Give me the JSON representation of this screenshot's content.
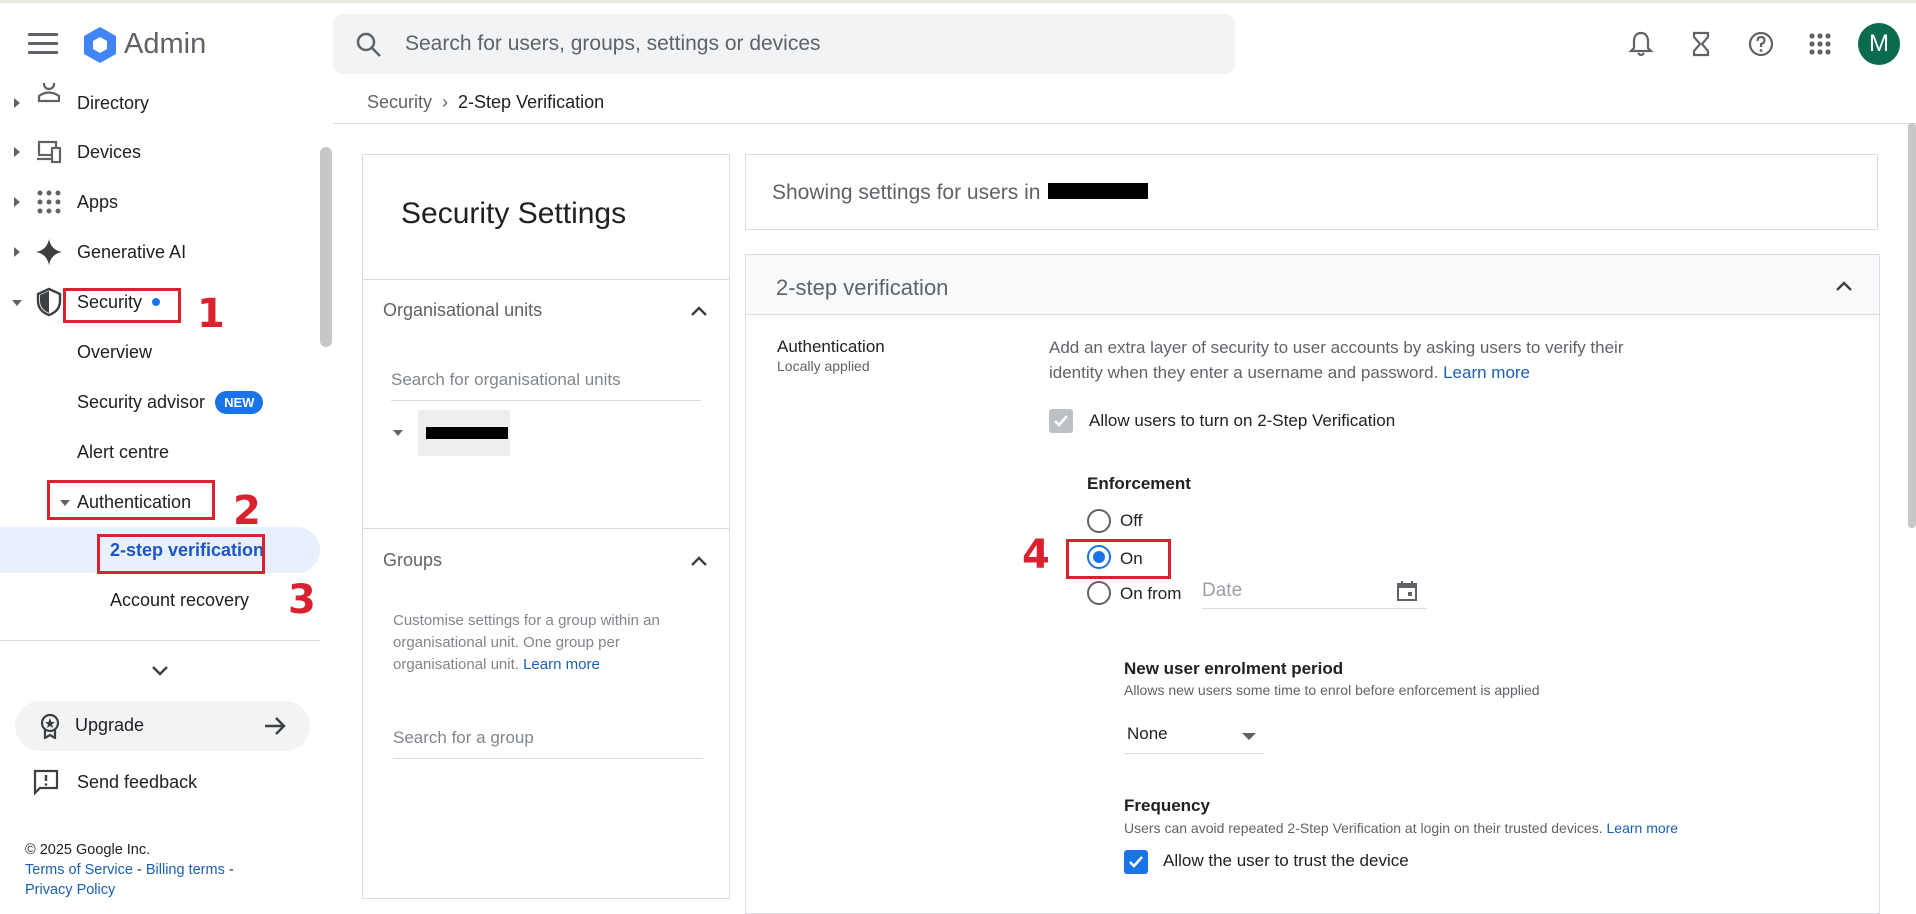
{
  "app": {
    "brand": "Admin",
    "avatar_letter": "M"
  },
  "search": {
    "placeholder": "Search for users, groups, settings or devices"
  },
  "sidebar": {
    "items": [
      {
        "label": "Directory"
      },
      {
        "label": "Devices"
      },
      {
        "label": "Apps"
      },
      {
        "label": "Generative AI"
      },
      {
        "label": "Security"
      },
      {
        "label": "Overview"
      },
      {
        "label": "Security advisor",
        "badge": "NEW"
      },
      {
        "label": "Alert centre"
      },
      {
        "label": "Authentication"
      },
      {
        "label": "2-step verification"
      },
      {
        "label": "Account recovery"
      }
    ],
    "upgrade": "Upgrade",
    "feedback": "Send feedback"
  },
  "footer": {
    "copyright": "© 2025 Google Inc.",
    "terms": "Terms of Service",
    "billing": "Billing terms",
    "privacy": "Privacy Policy"
  },
  "annotations": {
    "n1": "1",
    "n2": "2",
    "n3": "3",
    "n4": "4"
  },
  "breadcrumb": {
    "parent": "Security",
    "current": "2-Step Verification"
  },
  "left_panel": {
    "title": "Security Settings",
    "org_units": {
      "title": "Organisational units",
      "search_placeholder": "Search for organisational units"
    },
    "groups": {
      "title": "Groups",
      "description": "Customise settings for a group within an organisational unit. One group per organisational unit.",
      "learn_more": "Learn more",
      "search_placeholder": "Search for a group"
    }
  },
  "main": {
    "showing": "Showing settings for users in",
    "card_title": "2-step verification",
    "auth_label": "Authentication",
    "auth_sub": "Locally applied",
    "auth_desc": "Add an extra layer of security to user accounts by asking users to verify their identity when they enter a username and password.",
    "learn_more": "Learn more",
    "allow_label": "Allow users to turn on 2-Step Verification",
    "allow_checked": true,
    "enforcement": {
      "title": "Enforcement",
      "options": [
        "Off",
        "On",
        "On from"
      ],
      "selected": "On",
      "date_placeholder": "Date"
    },
    "enrolment": {
      "title": "New user enrolment period",
      "desc": "Allows new users some time to enrol before enforcement is applied",
      "value": "None"
    },
    "frequency": {
      "title": "Frequency",
      "desc": "Users can avoid repeated 2-Step Verification at login on their trusted devices.",
      "learn_more": "Learn more",
      "trust_label": "Allow the user to trust the device",
      "trust_checked": true
    }
  },
  "colors": {
    "accent": "#1a73e8",
    "annotation_red": "#d9212f",
    "avatar_bg": "#0b6b4f"
  }
}
